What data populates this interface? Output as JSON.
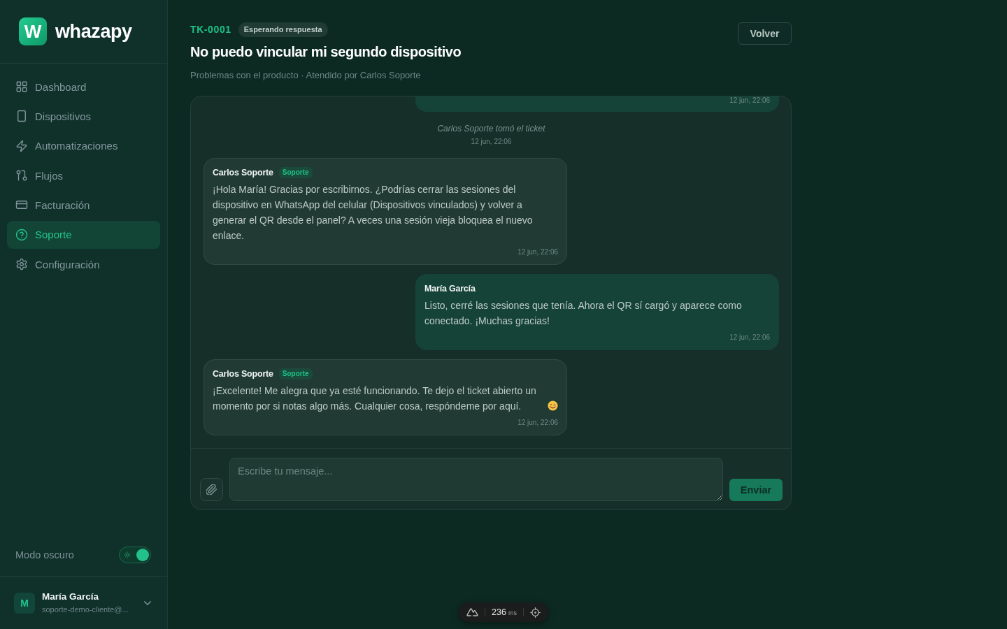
{
  "sidebar": {
    "logo_mark": "W",
    "brand": "whazapy",
    "nav": [
      {
        "label": "Dashboard",
        "selected": false
      },
      {
        "label": "Dispositivos",
        "selected": false
      },
      {
        "label": "Automatizaciones",
        "selected": false
      },
      {
        "label": "Flujos",
        "selected": false
      },
      {
        "label": "Facturación",
        "selected": false
      },
      {
        "label": "Soporte",
        "selected": true
      },
      {
        "label": "Configuración",
        "selected": false
      }
    ],
    "dark_mode": {
      "label": "Modo oscuro",
      "on": true
    },
    "user": {
      "avatar": "M",
      "name": "María García",
      "email": "soporte-demo-cliente@..."
    }
  },
  "ticket": {
    "id": "TK-0001",
    "status": "Esperando respuesta",
    "title": "No puedo vincular mi segundo dispositivo",
    "subtitle": "Problemas con el producto · Atendido por Carlos Soporte",
    "back_button": "Volver"
  },
  "chat": {
    "messages": [
      {
        "kind": "user",
        "clipped_top": true,
        "time": "12 jun, 22:06"
      },
      {
        "kind": "event",
        "text": "Carlos Soporte tomó el ticket",
        "time": "12 jun, 22:06"
      },
      {
        "kind": "agent",
        "author": "Carlos Soporte",
        "role": "Soporte",
        "text": "¡Hola María! Gracias por escribirnos. ¿Podrías cerrar las sesiones del dispositivo en WhatsApp del celular (Dispositivos vinculados) y volver a generar el QR desde el panel? A veces una sesión vieja bloquea el nuevo enlace.",
        "time": "12 jun, 22:06"
      },
      {
        "kind": "user",
        "author": "María García",
        "text": "Listo, cerré las sesiones que tenía. Ahora el QR sí cargó y aparece como conectado. ¡Muchas gracias!",
        "time": "12 jun, 22:06"
      },
      {
        "kind": "agent",
        "author": "Carlos Soporte",
        "role": "Soporte",
        "text": "¡Excelente! Me alegra que ya esté funcionando. Te dejo el ticket abierto un momento por si notas algo más. Cualquier cosa, respóndeme por aquí.",
        "emoji": true,
        "time": "12 jun, 22:06"
      }
    ],
    "composer": {
      "placeholder": "Escribe tu mensaje...",
      "send_button": "Enviar"
    }
  },
  "devtools": {
    "timing": "236",
    "unit": "ms"
  }
}
